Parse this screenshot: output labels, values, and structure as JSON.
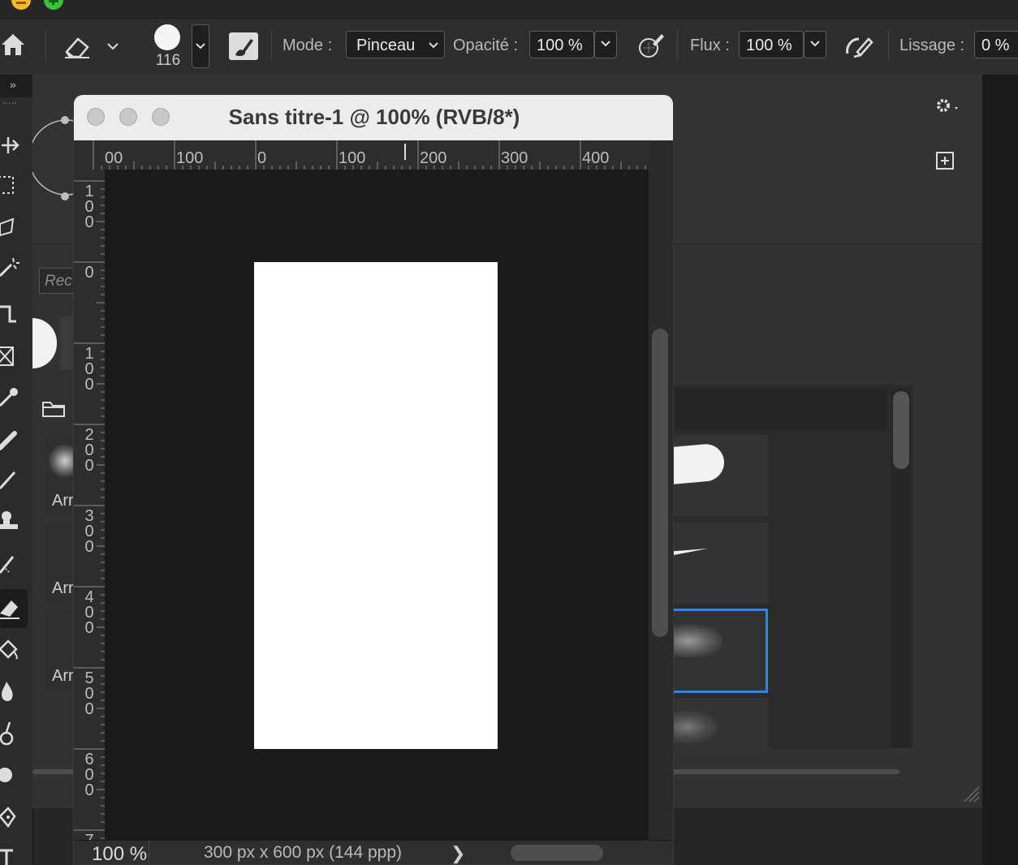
{
  "toolbar_options": {
    "brush_size": "116",
    "mode_label": "Mode :",
    "mode_value": "Pinceau",
    "opacity_label": "Opacité :",
    "opacity_value": "100 %",
    "flow_label": "Flux :",
    "flow_value": "100 %",
    "smoothing_label": "Lissage :",
    "smoothing_value": "0 %"
  },
  "document": {
    "title": "Sans titre-1 @ 100% (RVB/8*)",
    "zoom": "100 %",
    "info": "300 px x 600 px (144 ppp)",
    "status_arrow": "❯"
  },
  "rulers": {
    "horizontal": [
      "00",
      "100",
      "0",
      "100",
      "200",
      "300",
      "400"
    ],
    "vertical": [
      "1\n0\n0",
      "0",
      "1\n0\n0",
      "2\n0\n0",
      "3\n0\n0",
      "4\n0\n0",
      "5\n0\n0",
      "6\n0\n0",
      "7"
    ]
  },
  "panel": {
    "search_placeholder": "Rec",
    "brush_labels": [
      "Arr",
      "Arr",
      "Arr"
    ]
  },
  "colors": {
    "accent_selection": "#2f86e6",
    "canvas_page": "#ffffff",
    "workspace": "#1b1b1b"
  }
}
